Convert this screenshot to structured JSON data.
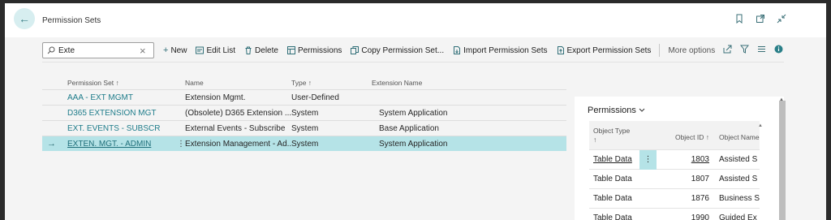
{
  "header": {
    "title": "Permission Sets",
    "icons": [
      "back-arrow-icon",
      "bookmark-icon",
      "open-new-window-icon",
      "collapse-icon"
    ]
  },
  "toolbar": {
    "search_value": "Exte",
    "new_label": "New",
    "edit_list_label": "Edit List",
    "delete_label": "Delete",
    "permissions_label": "Permissions",
    "copy_label": "Copy Permission Set...",
    "import_label": "Import Permission Sets",
    "export_label": "Export Permission Sets",
    "more_label": "More options"
  },
  "grid": {
    "headers": {
      "permission_set": "Permission Set ↑",
      "name": "Name",
      "type": "Type ↑",
      "extension_name": "Extension Name"
    },
    "rows": [
      {
        "set": "AAA - EXT MGMT",
        "name": "Extension Mgmt.",
        "type": "User-Defined",
        "ext": ""
      },
      {
        "set": "D365 EXTENSION MGT",
        "name": "(Obsolete) D365 Extension ...",
        "type": "System",
        "ext": "System Application"
      },
      {
        "set": "EXT. EVENTS - SUBSCR",
        "name": "External Events - Subscribe",
        "type": "System",
        "ext": "Base Application"
      },
      {
        "set": "EXTEN. MGT. - ADMIN",
        "name": "Extension Management - Ad...",
        "type": "System",
        "ext": "System Application"
      }
    ]
  },
  "factbox": {
    "title": "Permissions",
    "headers": {
      "object_type_line1": "Object Type",
      "object_type_line2": "↑",
      "object_id": "Object ID ↑",
      "object_name": "Object Name"
    },
    "rows": [
      {
        "type": "Table Data",
        "id": "1803",
        "name": "Assisted S"
      },
      {
        "type": "Table Data",
        "id": "1807",
        "name": "Assisted S"
      },
      {
        "type": "Table Data",
        "id": "1876",
        "name": "Business S"
      },
      {
        "type": "Table Data",
        "id": "1990",
        "name": "Guided Ex"
      }
    ]
  },
  "colors": {
    "accent": "#1e7c8a",
    "selected_row": "#b5e3e7",
    "back_button_bg": "#d7eef0"
  }
}
